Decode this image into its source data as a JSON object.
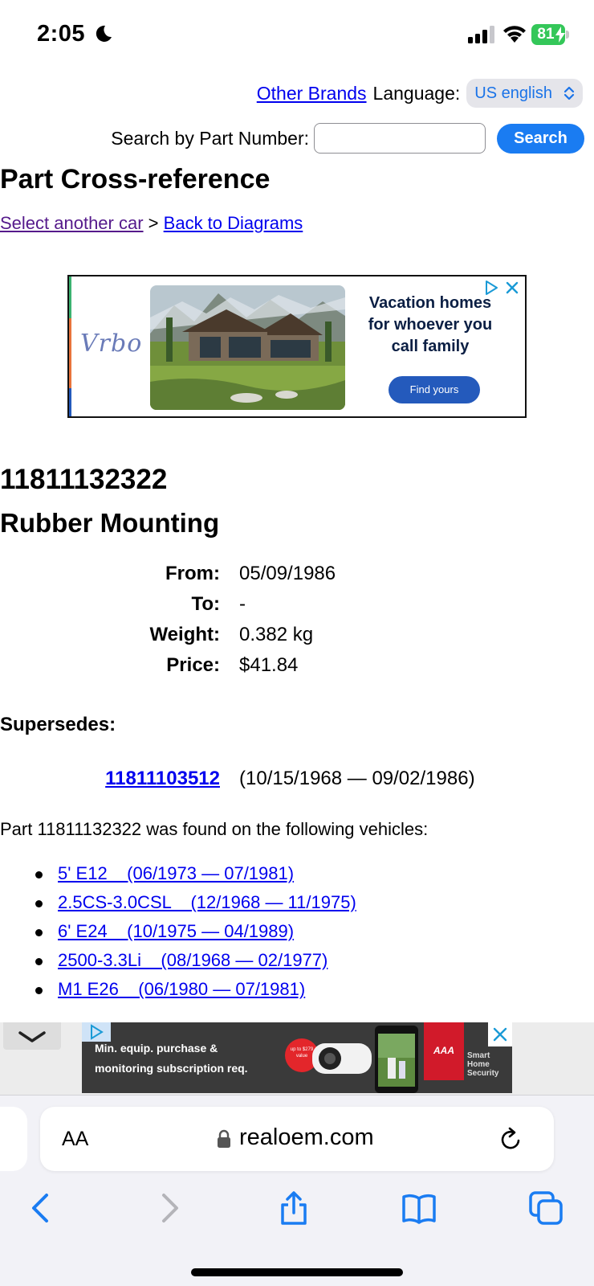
{
  "status_bar": {
    "time": "2:05",
    "battery": "81"
  },
  "header": {
    "other_brands": "Other Brands",
    "language_label": "Language:",
    "language_value": "US english",
    "search_label": "Search by Part Number:",
    "search_value": "",
    "search_button": "Search"
  },
  "page_title": "Part Cross-reference",
  "breadcrumb": {
    "select_car": "Select another car",
    "separator": ">",
    "back": "Back to Diagrams"
  },
  "ad": {
    "brand": "Vrbo",
    "text": "Vacation homes for whoever you call family",
    "cta": "Find yours"
  },
  "part": {
    "number": "11811132322",
    "name": "Rubber Mounting",
    "specs": [
      {
        "label": "From:",
        "value": "05/09/1986"
      },
      {
        "label": "To:",
        "value": "-"
      },
      {
        "label": "Weight:",
        "value": "0.382 kg"
      },
      {
        "label": "Price:",
        "value": "$41.84"
      }
    ]
  },
  "supersedes": {
    "heading": "Supersedes:",
    "number": "11811103512",
    "range": "(10/15/1968 — 09/02/1986)"
  },
  "vehicles": {
    "intro": "Part 11811132322 was found on the following vehicles:",
    "items": [
      "5' E12    (06/1973 — 07/1981)",
      "2.5CS-3.0CSL    (12/1968 — 11/1975)",
      "6' E24    (10/1975 — 04/1989)",
      "2500-3.3Li    (08/1968 — 02/1977)",
      "M1 E26    (06/1980 — 07/1981)"
    ]
  },
  "banner_ad": {
    "text_line1": "Min. equip. purchase &",
    "text_line2": "monitoring subscription req.",
    "badge": "up to $279 value",
    "brand": "AAA",
    "tagline": "Smart Home Security"
  },
  "browser": {
    "aa": "AA",
    "url": "realoem.com"
  }
}
